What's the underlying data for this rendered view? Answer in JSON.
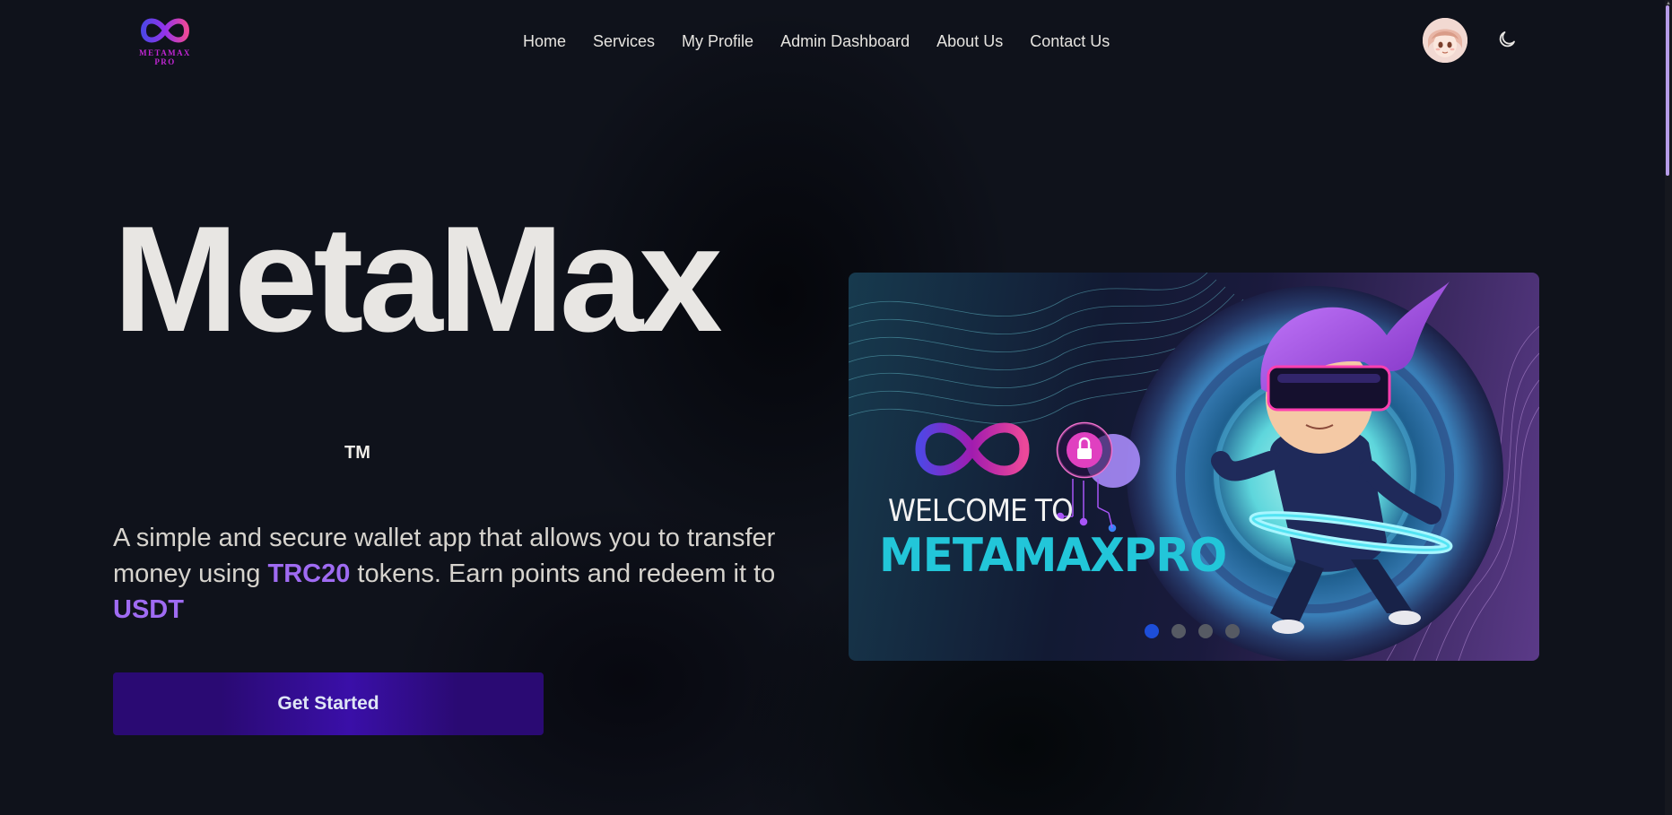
{
  "brand": {
    "logo_text_line1": "METAMAX",
    "logo_text_line2": "PRO"
  },
  "nav": {
    "items": [
      {
        "label": "Home"
      },
      {
        "label": "Services"
      },
      {
        "label": "My Profile"
      },
      {
        "label": "Admin Dashboard"
      },
      {
        "label": "About Us"
      },
      {
        "label": "Contact Us"
      }
    ]
  },
  "header": {
    "avatar_icon": "user-avatar",
    "theme_icon": "moon-icon"
  },
  "hero": {
    "title": "MetaMax",
    "trademark": "TM",
    "desc_part1": "A simple and secure wallet app that allows you to transfer money using ",
    "desc_highlight1": "TRC20",
    "desc_part2": " tokens. Earn points and redeem it to ",
    "desc_highlight2": "USDT",
    "cta_label": "Get Started"
  },
  "carousel": {
    "slide_text_small": "WELCOME TO",
    "slide_text_big": "METAMAXPRO",
    "slide_count": 4,
    "active_slide": 1
  },
  "colors": {
    "background": "#0f121b",
    "accent_purple": "#9f6bf2",
    "button_bg": "#2a0a73",
    "cyan_text": "#22c6d9",
    "active_dot": "#1d4ed8"
  }
}
